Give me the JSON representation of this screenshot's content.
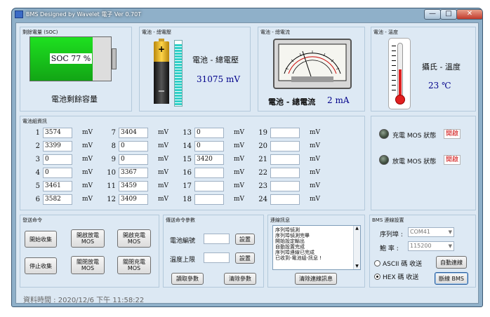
{
  "window": {
    "title": "BMS Designed by Wavelet 電子   Ver 0.70T",
    "min_label": "—",
    "max_label": "□",
    "close_label": "✕"
  },
  "soc": {
    "title": "剩餘電量 (SOC)",
    "display": "SOC 77 %",
    "value": 77,
    "caption": "電池剩餘容量",
    "color": "#17c51a"
  },
  "voltage": {
    "title": "電池 - 總電壓",
    "label": "電池 - 總電壓",
    "value": "31075 mV",
    "bar_level": 0.95
  },
  "current": {
    "title": "電池 - 總電流",
    "label": "電池 - 總電流",
    "value": "2 mA"
  },
  "temperature": {
    "title": "電池 - 溫度",
    "label": "攝氏 - 溫度",
    "value": "23 ℃"
  },
  "cells": {
    "title": "電池組資訊",
    "unit": "mV",
    "items": [
      {
        "label": "1",
        "value": "3574"
      },
      {
        "label": "2",
        "value": "3399"
      },
      {
        "label": "3",
        "value": "0"
      },
      {
        "label": "4",
        "value": "0"
      },
      {
        "label": "5",
        "value": "3461"
      },
      {
        "label": "6",
        "value": "3582"
      },
      {
        "label": "7",
        "value": "3404"
      },
      {
        "label": "8",
        "value": "0"
      },
      {
        "label": "9",
        "value": "0"
      },
      {
        "label": "10",
        "value": "3367"
      },
      {
        "label": "11",
        "value": "3459"
      },
      {
        "label": "12",
        "value": "3409"
      },
      {
        "label": "13",
        "value": "0"
      },
      {
        "label": "14",
        "value": "0"
      },
      {
        "label": "15",
        "value": "3420"
      },
      {
        "label": "16",
        "value": ""
      },
      {
        "label": "17",
        "value": ""
      },
      {
        "label": "18",
        "value": ""
      },
      {
        "label": "19",
        "value": ""
      },
      {
        "label": "20",
        "value": ""
      },
      {
        "label": "21",
        "value": ""
      },
      {
        "label": "22",
        "value": ""
      },
      {
        "label": "23",
        "value": ""
      },
      {
        "label": "24",
        "value": ""
      }
    ]
  },
  "mos": {
    "charge_label": "充電 MOS 狀態",
    "charge_state": "開啟",
    "discharge_label": "放電 MOS 狀態",
    "discharge_state": "開啟"
  },
  "commands": {
    "title": "發送命令",
    "start": "開始收集",
    "open_discharge": "開啟放電\nMOS",
    "open_charge": "開啟充電\nMOS",
    "stop": "停止收集",
    "close_discharge": "關閉放電\nMOS",
    "close_charge": "關閉充電\nMOS"
  },
  "params": {
    "title": "傳送命令參數",
    "battery_id_label": "電池編號",
    "temp_limit_label": "溫度上限",
    "set1": "設置",
    "set2": "設置",
    "read": "讀取參數",
    "clear": "清除參數",
    "battery_id_value": "",
    "temp_limit_value": ""
  },
  "log": {
    "title": "連線訊息",
    "lines": [
      "序列埠偵測",
      "序列埠偵測完畢",
      "開始設定輸出",
      "自動設置完成",
      "序列埠連線已完成",
      "已收到-電池組-訊息 !"
    ],
    "clear": "清除連線訊息"
  },
  "connection": {
    "title": "BMS 連線設置",
    "port_label": "序列埠 :",
    "port_value": "COM41",
    "baud_label": "鮑  率 :",
    "baud_value": "115200",
    "ascii_label": "ASCII 碼 收送",
    "hex_label": "HEX 碼 收送",
    "auto_connect": "自動連線",
    "disconnect": "斷線 BMS",
    "selected": "hex"
  },
  "status": {
    "text": "資料時間 : 2020/12/6 下午 11:58:22"
  }
}
